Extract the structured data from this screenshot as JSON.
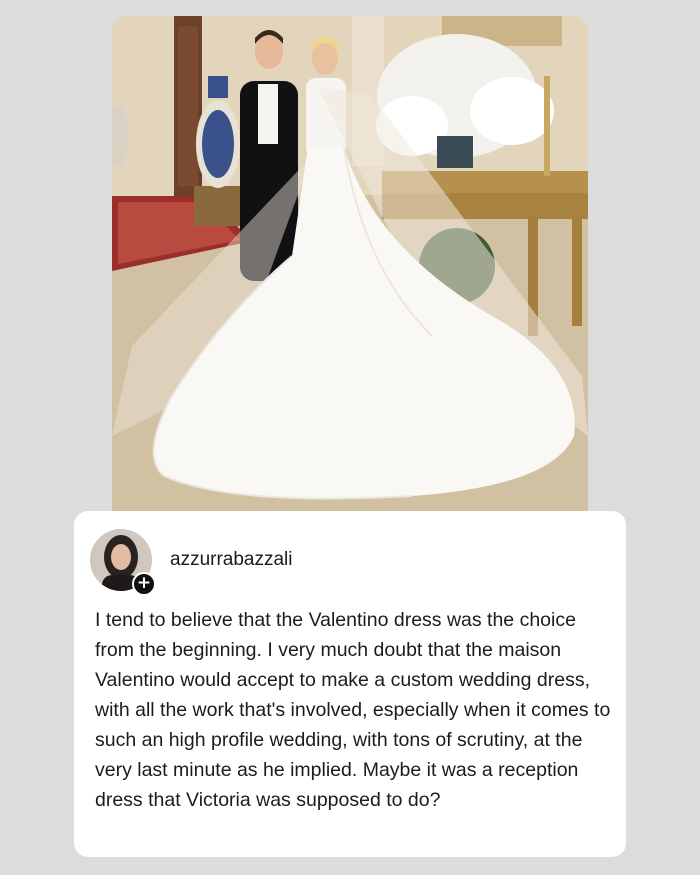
{
  "post": {
    "image_alt_name": "wedding-photo",
    "author": {
      "username": "azzurrabazzali",
      "follow_icon": "plus-icon"
    },
    "comment_text": "I tend to believe that the Valentino dress was the choice from the beginning. I very much doubt that the maison Valentino would accept to make a custom wedding dress, with all the work that's involved, especially when it comes to such an high profile wedding, with tons of scrutiny, at the very last minute as he implied. Maybe it was a reception dress that Victoria was supposed to do?"
  },
  "colors": {
    "background": "#dcdcdc",
    "card": "#ffffff",
    "text": "#1c1c1c"
  }
}
